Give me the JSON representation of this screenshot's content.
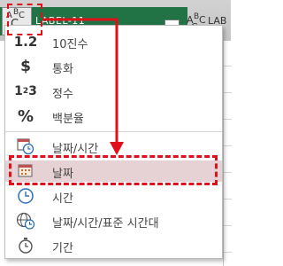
{
  "header": {
    "column_title": "LABEL-11",
    "next_column_title": "LAB",
    "type_icon": "abc-text-type-icon"
  },
  "menu": {
    "items": [
      {
        "id": "decimal",
        "label": "10진수",
        "icon": "decimal-number-icon",
        "glyph": "1.2"
      },
      {
        "id": "currency",
        "label": "통화",
        "icon": "currency-icon",
        "glyph": "$"
      },
      {
        "id": "integer",
        "label": "정수",
        "icon": "integer-icon",
        "glyph": "1²3"
      },
      {
        "id": "percent",
        "label": "백분율",
        "icon": "percent-icon",
        "glyph": "%"
      },
      {
        "id": "datetime",
        "label": "날짜/시간",
        "icon": "calendar-clock-icon"
      },
      {
        "id": "date",
        "label": "날짜",
        "icon": "calendar-icon",
        "selected": true
      },
      {
        "id": "time",
        "label": "시간",
        "icon": "clock-icon"
      },
      {
        "id": "datetimezone",
        "label": "날짜/시간/표준 시간대",
        "icon": "globe-clock-icon"
      },
      {
        "id": "duration",
        "label": "기간",
        "icon": "stopwatch-icon"
      }
    ]
  },
  "colors": {
    "header_green": "#217346",
    "highlight_red": "#e0101a",
    "selected_bg": "#e6d2d4"
  }
}
